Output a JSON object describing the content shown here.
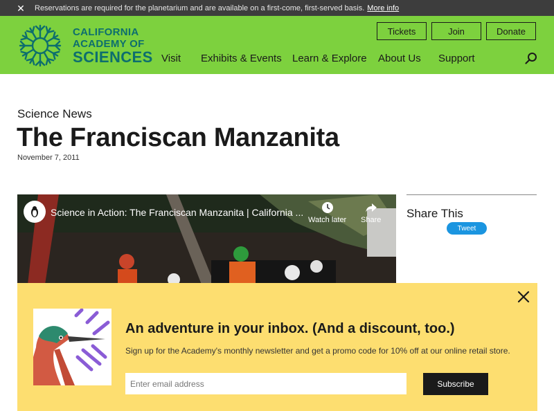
{
  "alert": {
    "message": "Reservations are required for the planetarium and are available on a first-come, first-served basis.",
    "link": "More info"
  },
  "logo": {
    "line1": "CALIFORNIA",
    "line2": "ACADEMY OF",
    "line3": "SCIENCES",
    "color": "#0d6e6e"
  },
  "utility": {
    "tickets": "Tickets",
    "join": "Join",
    "donate": "Donate"
  },
  "nav": {
    "items": [
      "Visit",
      "Exhibits & Events",
      "Learn & Explore",
      "About Us",
      "Support"
    ]
  },
  "article": {
    "eyebrow": "Science News",
    "title": "The Franciscan Manzanita",
    "date": "November 7, 2011"
  },
  "video": {
    "title": "Science in Action: The Franciscan Manzanita | California ...",
    "watch_later": "Watch later",
    "share": "Share"
  },
  "share": {
    "label": "Share This",
    "tweet": "Tweet"
  },
  "newsletter": {
    "headline": "An adventure in your inbox. (And a discount, too.)",
    "subtext": "Sign up for the Academy's monthly newsletter and get a promo code for 10% off at our online retail store.",
    "email_placeholder": "Enter email address",
    "email_value": "",
    "subscribe": "Subscribe",
    "background": "#fdde70"
  },
  "colors": {
    "header_green": "#7dd13e",
    "alert_bg": "#3d3d3d",
    "tweet_blue": "#1b95e0"
  },
  "icons": {
    "close": "close-icon",
    "search": "search-icon",
    "clock": "clock-icon",
    "share": "share-arrow-icon"
  }
}
